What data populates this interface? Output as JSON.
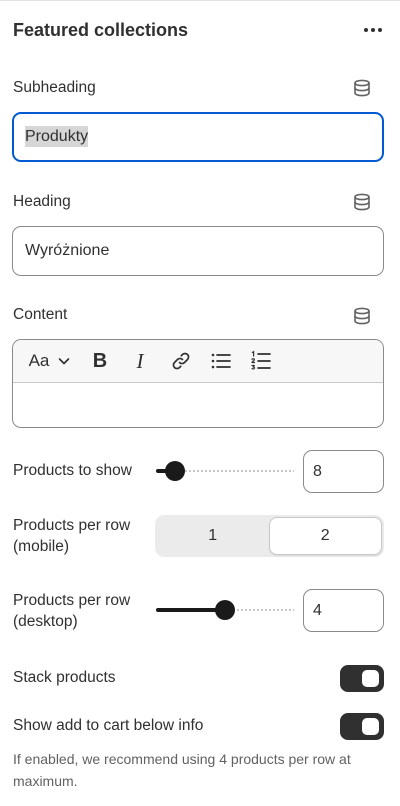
{
  "panel": {
    "title": "Featured collections",
    "more_icon": "more-horizontal-icon"
  },
  "fields": {
    "subheading": {
      "label": "Subheading",
      "value": "Produkty",
      "icon": "database-icon"
    },
    "heading": {
      "label": "Heading",
      "value": "Wyróżnione",
      "icon": "database-icon"
    },
    "content": {
      "label": "Content",
      "icon": "database-icon",
      "toolbar": {
        "text_style_label": "Aa",
        "bold_label": "B",
        "italic_label": "I",
        "icons": [
          "text-style-icon",
          "chevron-down-icon",
          "bold-icon",
          "italic-icon",
          "link-icon",
          "bulleted-list-icon",
          "numbered-list-icon"
        ]
      },
      "value": ""
    },
    "products_to_show": {
      "label": "Products to show",
      "value": "8",
      "slider_fraction": 0.14
    },
    "products_per_row_mobile": {
      "label_line1": "Products per row",
      "label_line2": "(mobile)",
      "options": [
        "1",
        "2"
      ],
      "selected": "2"
    },
    "products_per_row_desktop": {
      "label_line1": "Products per row",
      "label_line2": "(desktop)",
      "value": "4",
      "slider_fraction": 0.5
    },
    "stack_products": {
      "label": "Stack products",
      "enabled": true
    },
    "show_add_to_cart": {
      "label": "Show add to cart below info",
      "enabled": true,
      "help_text": "If enabled, we recommend using 4 products per row at maximum."
    }
  },
  "colors": {
    "focus": "#005bd3",
    "toggle_on": "#303030",
    "text": "#303030",
    "muted": "#616161"
  }
}
